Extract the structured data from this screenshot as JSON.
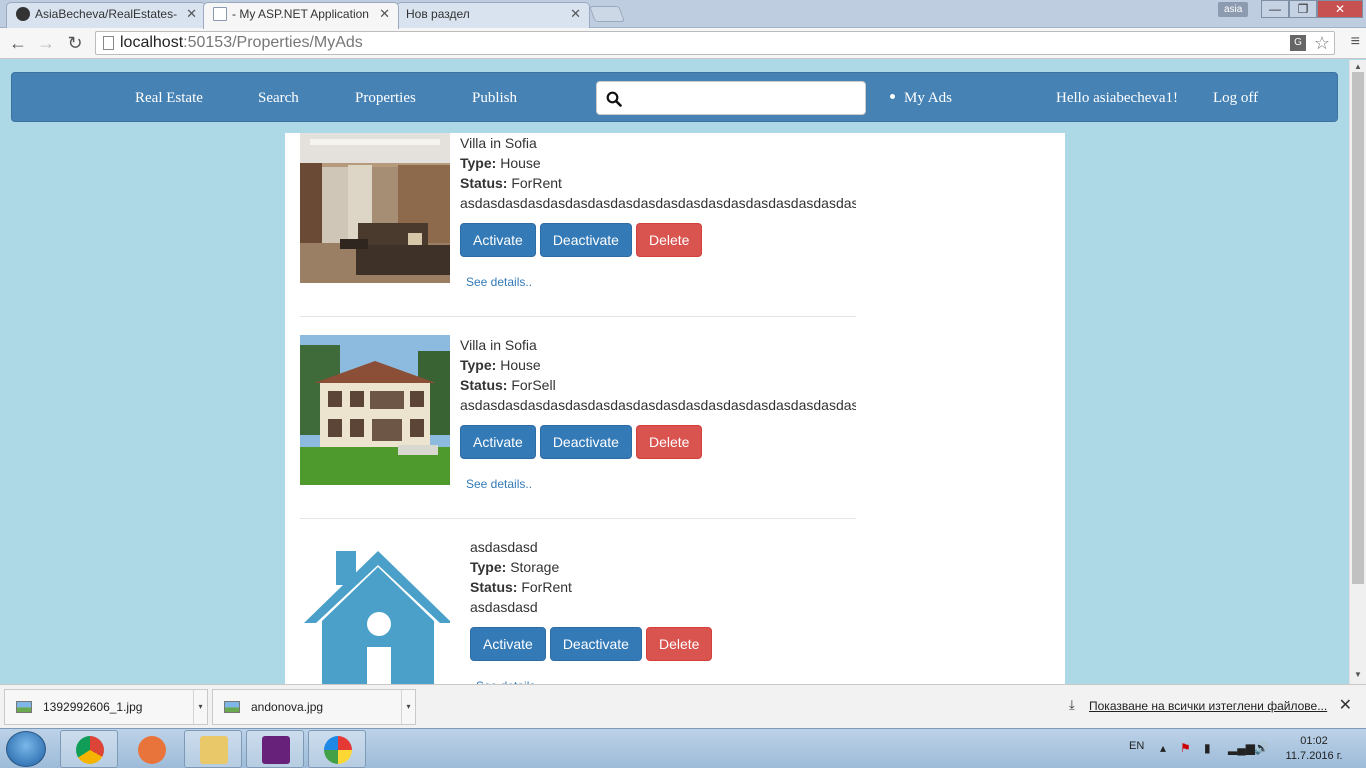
{
  "browser": {
    "tabs": [
      {
        "title": "AsiaBecheva/RealEstates-",
        "icon": "github-icon"
      },
      {
        "title": " - My ASP.NET Application",
        "icon": "page-icon"
      },
      {
        "title": "Нов раздел",
        "icon": "none"
      }
    ],
    "user_badge": "asia",
    "url_host": "localhost",
    "url_path": ":50153/Properties/MyAds"
  },
  "navbar": {
    "brand": "Real Estate",
    "links": [
      "Search",
      "Properties",
      "Publish"
    ],
    "search_placeholder": "",
    "my_ads": "My Ads",
    "greeting": "Hello asiabecheva1!",
    "logoff": "Log off"
  },
  "labels": {
    "type": "Type:",
    "status": "Status:",
    "activate": "Activate",
    "deactivate": "Deactivate",
    "delete": "Delete",
    "see_details": "See details.."
  },
  "ads": [
    {
      "title": "Villa in Sofia",
      "type": "House",
      "status": "ForRent",
      "description": "asdasdasdasdasdasdasdasdasdasdasdasdasdasdasdasdasdasdasd",
      "image": "living-room-photo"
    },
    {
      "title": "Villa in Sofia",
      "type": "House",
      "status": "ForSell",
      "description": "asdasdasdasdasdasdasdasdasdasdasdasdasdasdasdasdasdasdasd",
      "image": "villa-exterior-photo"
    },
    {
      "title": "asdasdasd",
      "type": "Storage",
      "status": "ForRent",
      "description": "asdasdasd",
      "image": "house-icon"
    }
  ],
  "downloads": {
    "items": [
      "1392992606_1.jpg",
      "andonova.jpg"
    ],
    "show_all": "Показване на всички изтеглени файлове..."
  },
  "taskbar": {
    "language": "EN",
    "time": "01:02",
    "date": "11.7.2016 г."
  }
}
